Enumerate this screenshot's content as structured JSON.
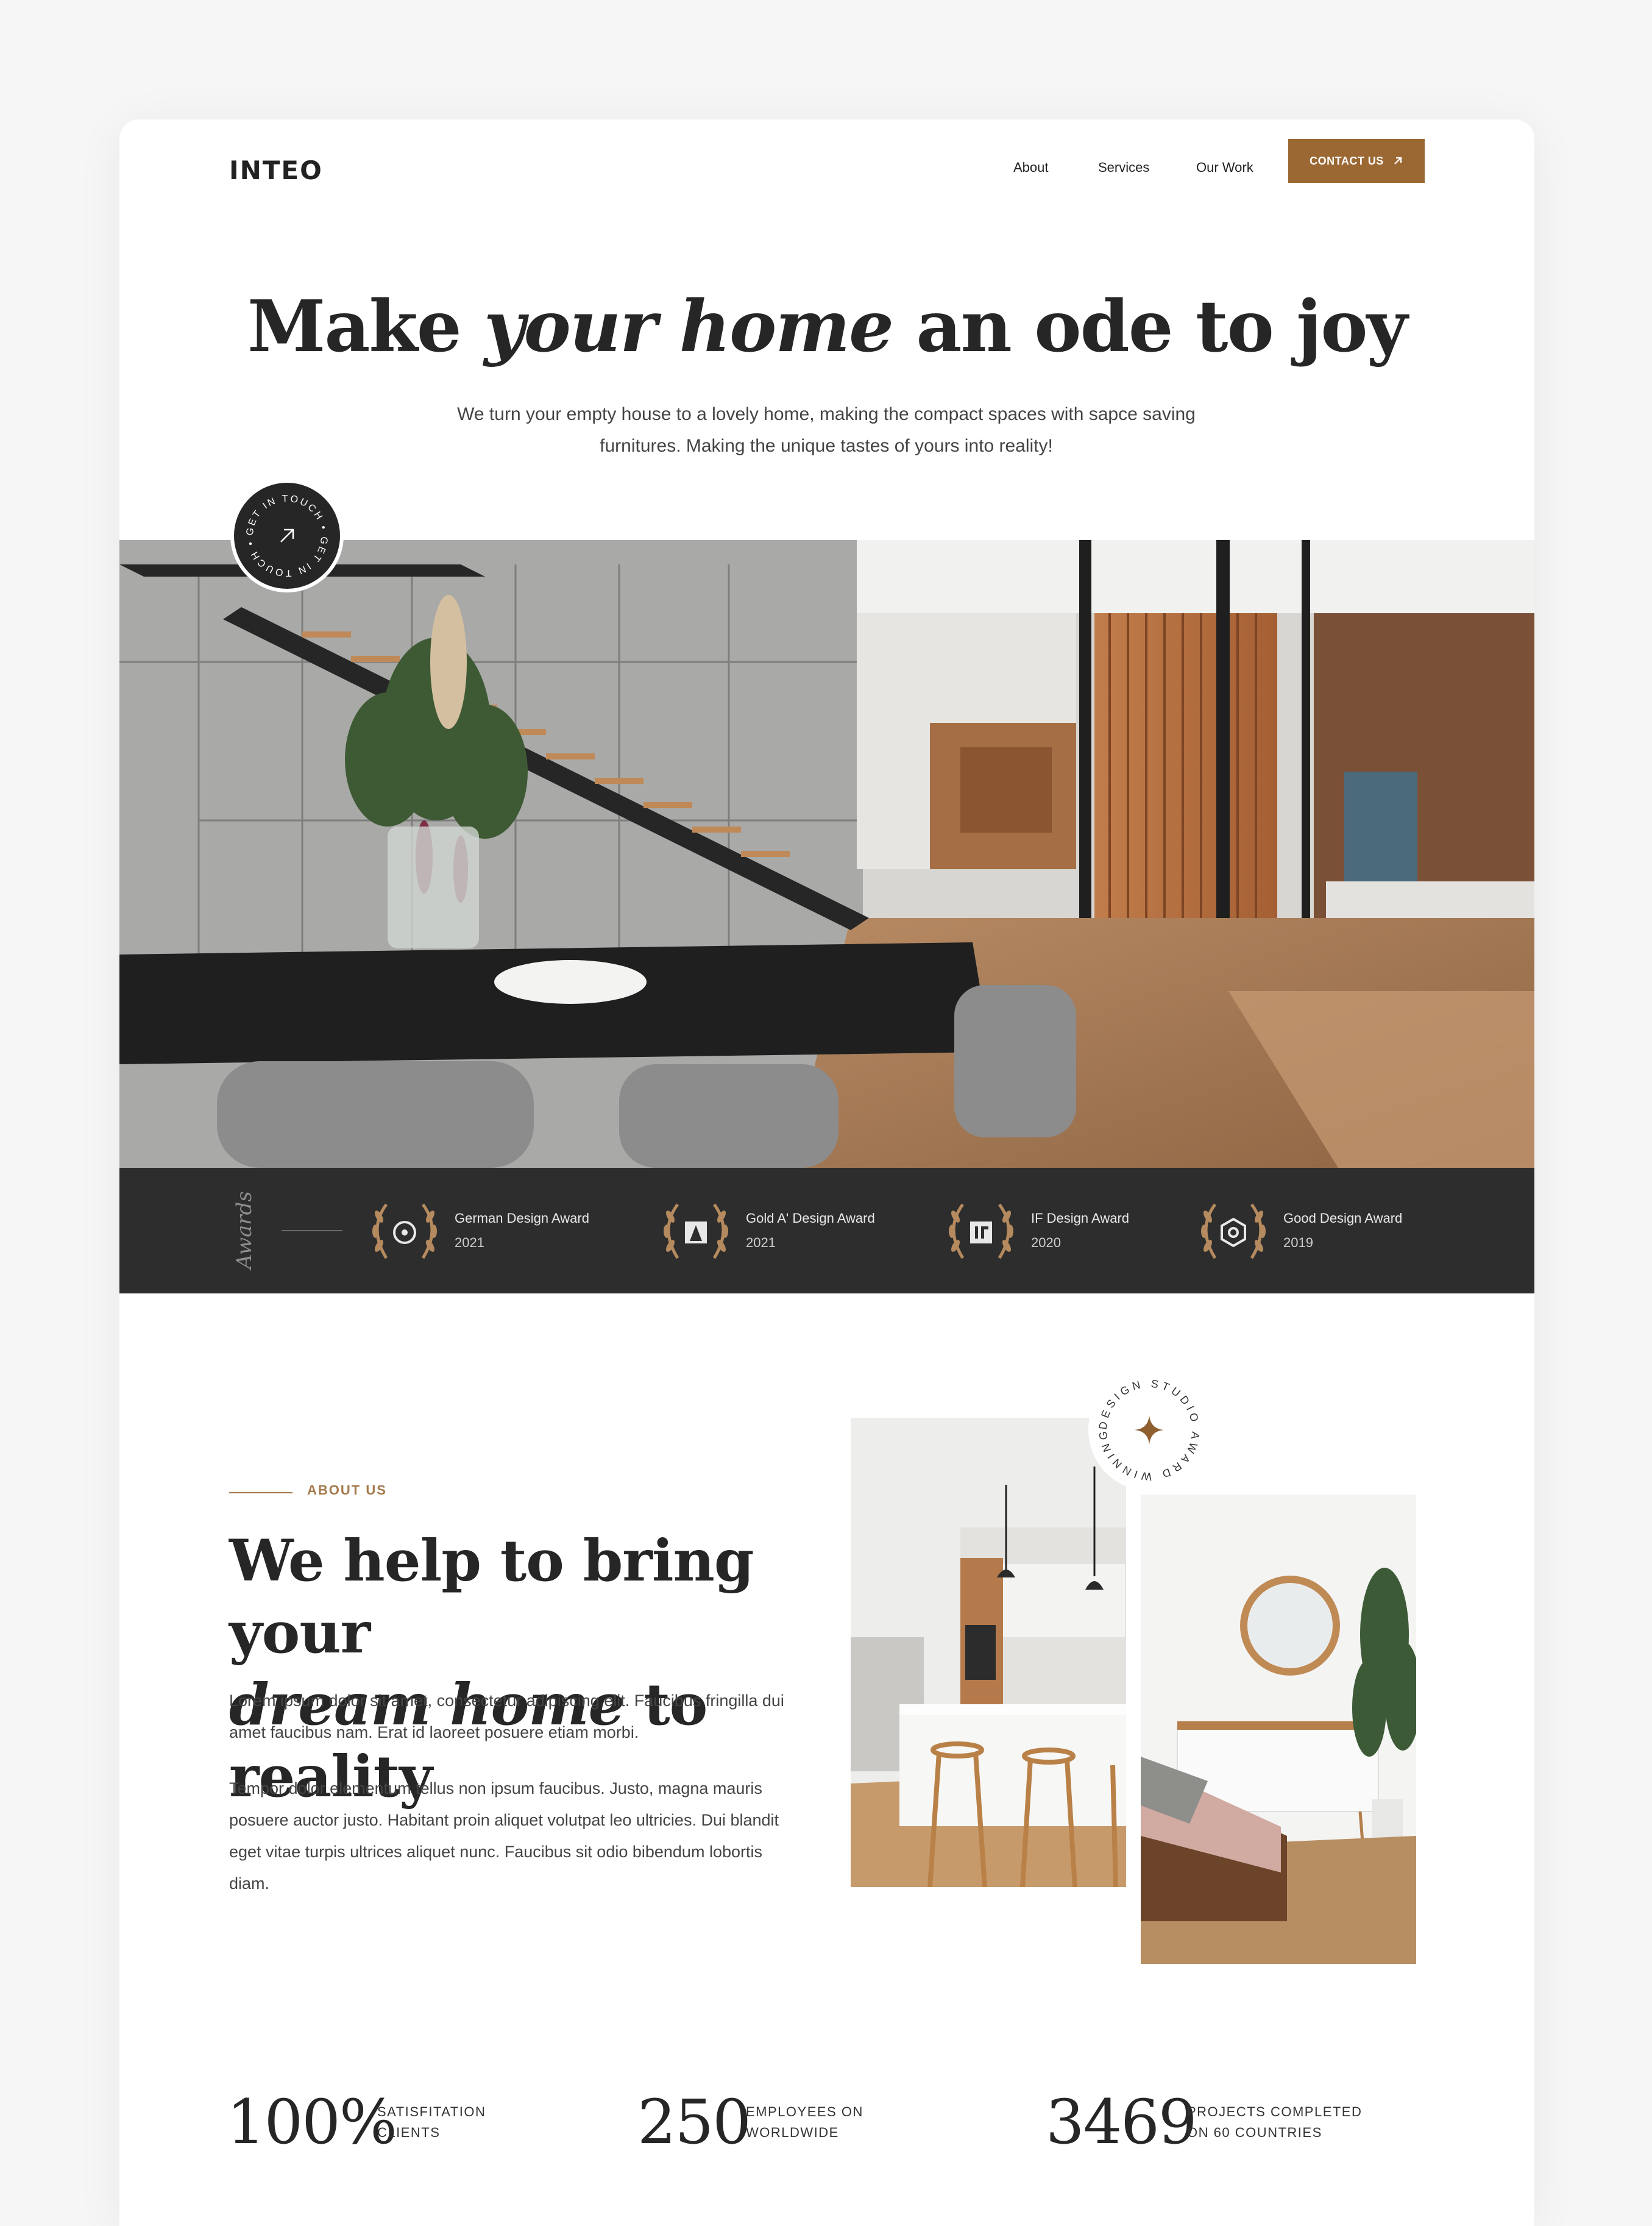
{
  "header": {
    "logo": "INTEO",
    "nav": [
      "About",
      "Services",
      "Our Work"
    ],
    "contact_label": "CONTACT US"
  },
  "hero": {
    "title_pre": "Make ",
    "title_em": "your home",
    "title_post": " an ode to joy",
    "subtitle_line1": "We turn your empty house to a lovely home, making the compact spaces  with sapce saving",
    "subtitle_line2": "furnitures. Making the unique tastes of yours into reality!",
    "badge_text": "GET IN TOUCH • GET IN TOUCH •"
  },
  "awards": {
    "label": "Awards",
    "items": [
      {
        "name": "German Design Award",
        "year": "2021"
      },
      {
        "name": "Gold A' Design Award",
        "year": "2021"
      },
      {
        "name": "IF Design Award",
        "year": "2020"
      },
      {
        "name": "Good Design Award",
        "year": "2019"
      }
    ]
  },
  "about": {
    "tag": "ABOUT US",
    "title_line1": "We help to bring your",
    "title_em": "dream home",
    "title_post": " to reality",
    "p1": "Lorem ipsum dolor sit amet, consectetur adipiscing elit. Faucibus fringilla dui amet faucibus nam. Erat id laoreet posuere etiam morbi.",
    "p2": "Tempor dolor elementum tellus non ipsum faucibus. Justo, magna mauris posuere auctor justo. Habitant proin aliquet volutpat leo ultricies. Dui blandit eget vitae turpis ultrices aliquet nunc. Faucibus sit odio bibendum lobortis diam.",
    "badge_text": "DESIGN STUDIO AWARD WINNING"
  },
  "stats": [
    {
      "value": "100%",
      "label1": "SATISFITATION",
      "label2": "CLIENTS"
    },
    {
      "value": "250",
      "label1": "EMPLOYEES ON",
      "label2": "WORLDWIDE"
    },
    {
      "value": "3469",
      "label1": "PROJECTS COMPLETED",
      "label2": "ON 60 COUNTRIES"
    }
  ],
  "colors": {
    "accent": "#9b6833",
    "dark": "#2d2d2d",
    "text": "#262626"
  }
}
